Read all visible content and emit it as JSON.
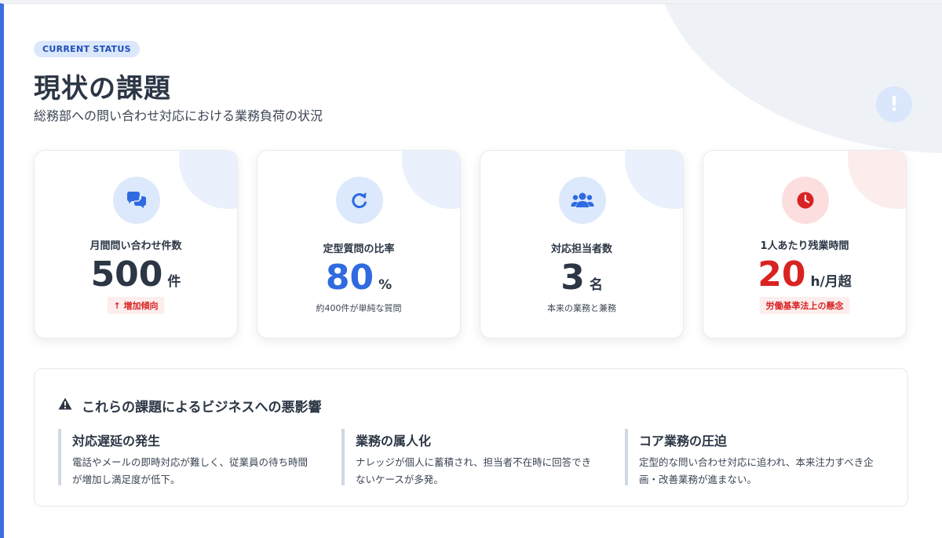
{
  "header": {
    "tag": "CURRENT STATUS",
    "title": "現状の課題",
    "subtitle": "総務部への問い合わせ対応における業務負荷の状況"
  },
  "cards": [
    {
      "icon": "chat-bubbles-icon",
      "label": "月間問い合わせ件数",
      "value": "500",
      "unit": "件",
      "badge": "↑ 増加傾向"
    },
    {
      "icon": "refresh-icon",
      "label": "定型質問の比率",
      "value": "80",
      "unit": "%",
      "note": "約400件が単純な質問"
    },
    {
      "icon": "users-icon",
      "label": "対応担当者数",
      "value": "3",
      "unit": "名",
      "note": "本来の業務と兼務"
    },
    {
      "icon": "clock-icon",
      "label": "1人あたり残業時間",
      "value": "20",
      "unit": "h/月超",
      "badge": "労働基準法上の懸念"
    }
  ],
  "impact": {
    "title": "これらの課題によるビジネスへの悪影響",
    "items": [
      {
        "heading": "対応遅延の発生",
        "text": "電話やメールの即時対応が難しく、従業員の待ち時間が増加し満足度が低下。"
      },
      {
        "heading": "業務の属人化",
        "text": "ナレッジが個人に蓄積され、担当者不在時に回答できないケースが多発。"
      },
      {
        "heading": "コア業務の圧迫",
        "text": "定型的な問い合わせ対応に追われ、本来注力すべき企画・改善業務が進まない。"
      }
    ]
  },
  "colors": {
    "accent": "#2f6ae0",
    "danger": "#d92323",
    "text": "#2c3645"
  }
}
